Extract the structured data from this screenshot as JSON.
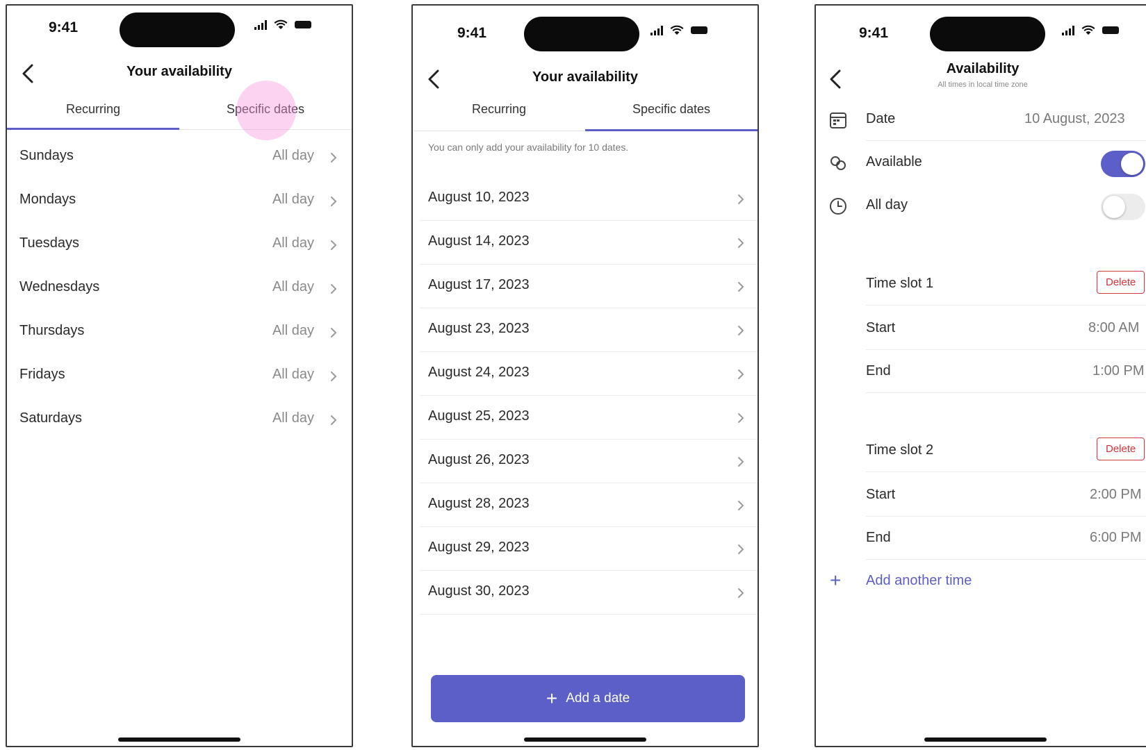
{
  "status_bar": {
    "time": "9:41"
  },
  "screen_recurring": {
    "title": "Your availability",
    "tabs": [
      {
        "label": "Recurring",
        "active": true
      },
      {
        "label": "Specific dates",
        "active": false
      }
    ],
    "days": [
      {
        "label": "Sundays",
        "value": "All day"
      },
      {
        "label": "Mondays",
        "value": "All day"
      },
      {
        "label": "Tuesdays",
        "value": "All day"
      },
      {
        "label": "Wednesdays",
        "value": "All day"
      },
      {
        "label": "Thursdays",
        "value": "All day"
      },
      {
        "label": "Fridays",
        "value": "All day"
      },
      {
        "label": "Saturdays",
        "value": "All day"
      }
    ]
  },
  "screen_specific": {
    "title": "Your availability",
    "tabs": [
      {
        "label": "Recurring",
        "active": false
      },
      {
        "label": "Specific dates",
        "active": true
      }
    ],
    "note": "You can only add your availability for 10 dates.",
    "dates": [
      "August 10, 2023",
      "August 14, 2023",
      "August 17, 2023",
      "August 23, 2023",
      "August 24, 2023",
      "August 25, 2023",
      "August 26, 2023",
      "August 28, 2023",
      "August 29, 2023",
      "August 30, 2023"
    ],
    "add_button": "Add a date"
  },
  "screen_detail": {
    "title": "Availability",
    "subtitle": "All times in local time zone",
    "date_label": "Date",
    "date_value": "10 August, 2023",
    "available_label": "Available",
    "available_on": true,
    "allday_label": "All day",
    "allday_on": false,
    "slots": [
      {
        "label": "Time slot 1",
        "delete": "Delete",
        "start_label": "Start",
        "start": "8:00 AM",
        "end_label": "End",
        "end": "1:00 PM"
      },
      {
        "label": "Time slot 2",
        "delete": "Delete",
        "start_label": "Start",
        "start": "2:00 PM",
        "end_label": "End",
        "end": "6:00 PM"
      }
    ],
    "add_time": "Add another time"
  },
  "colors": {
    "accent": "#5b5fc7",
    "danger": "#d2363c",
    "touch_highlight": "#f896dc"
  }
}
